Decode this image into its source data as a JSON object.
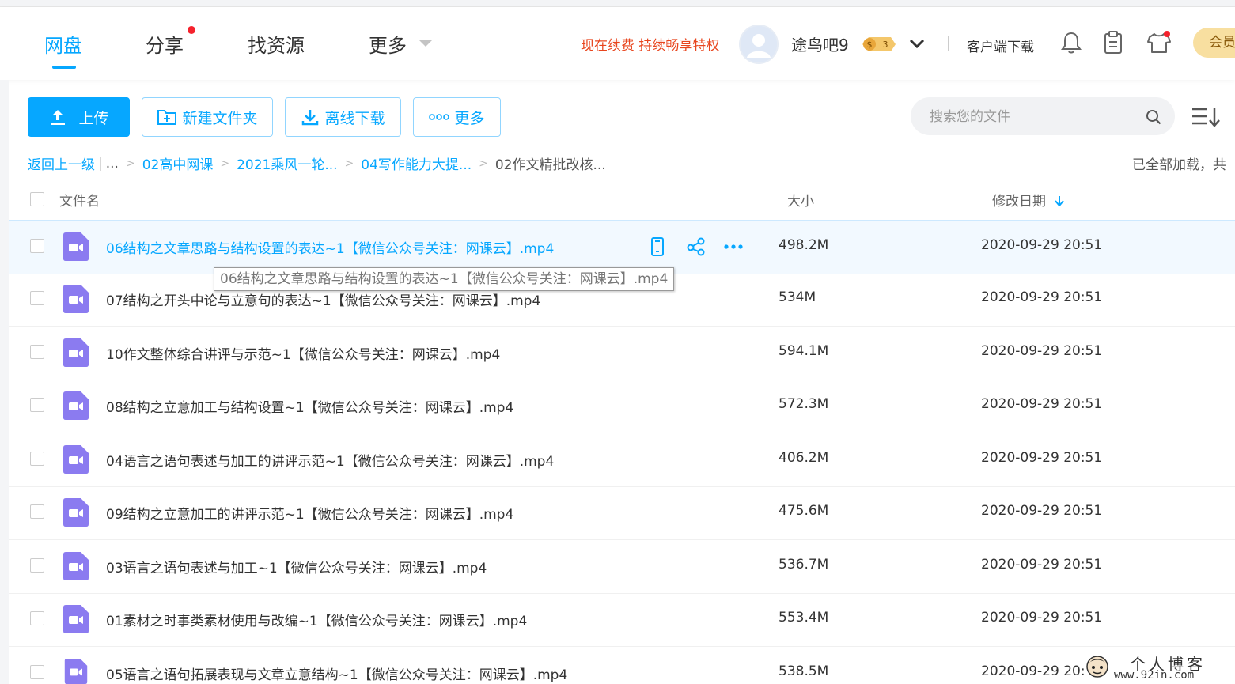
{
  "nav": {
    "items": [
      {
        "label": "网盘",
        "active": true
      },
      {
        "label": "分享",
        "badge": true
      },
      {
        "label": "找资源"
      },
      {
        "label": "更多",
        "dropdown": true
      }
    ]
  },
  "header": {
    "promo": "现在续费 持续畅享特权",
    "username": "途鸟吧9",
    "coin_level": "3",
    "client_download": "客户端下载",
    "vip_label": "会员"
  },
  "toolbar": {
    "upload": "上传",
    "new_folder": "新建文件夹",
    "offline_download": "离线下载",
    "more": "更多",
    "search_placeholder": "搜索您的文件"
  },
  "breadcrumb": {
    "back": "返回上一级",
    "ellipsis": "...",
    "items": [
      "02高中网课",
      "2021乘风一轮...",
      "04写作能力大提..."
    ],
    "current": "02作文精批改核..."
  },
  "status": {
    "loaded": "已全部加载，共"
  },
  "table": {
    "columns": {
      "name": "文件名",
      "size": "大小",
      "date": "修改日期"
    },
    "rows": [
      {
        "name": "06结构之文章思路与结构设置的表达~1【微信公众号关注：网课云】.mp4",
        "size": "498.2M",
        "date": "2020-09-29 20:51"
      },
      {
        "name": "07结构之开头中论与立意句的表达~1【微信公众号关注：网课云】.mp4",
        "size": "534M",
        "date": "2020-09-29 20:51"
      },
      {
        "name": "10作文整体综合讲评与示范~1【微信公众号关注：网课云】.mp4",
        "size": "594.1M",
        "date": "2020-09-29 20:51"
      },
      {
        "name": "08结构之立意加工与结构设置~1【微信公众号关注：网课云】.mp4",
        "size": "572.3M",
        "date": "2020-09-29 20:51"
      },
      {
        "name": "04语言之语句表述与加工的讲评示范~1【微信公众号关注：网课云】.mp4",
        "size": "406.2M",
        "date": "2020-09-29 20:51"
      },
      {
        "name": "09结构之立意加工的讲评示范~1【微信公众号关注：网课云】.mp4",
        "size": "475.6M",
        "date": "2020-09-29 20:51"
      },
      {
        "name": "03语言之语句表述与加工~1【微信公众号关注：网课云】.mp4",
        "size": "536.7M",
        "date": "2020-09-29 20:51"
      },
      {
        "name": "01素材之时事类素材使用与改编~1【微信公众号关注：网课云】.mp4",
        "size": "553.4M",
        "date": "2020-09-29 20:51"
      },
      {
        "name": "05语言之语句拓展表现与文章立意结构~1【微信公众号关注：网课云】.mp4",
        "size": "538.5M",
        "date": "2020-09-29 20:51"
      }
    ]
  },
  "tooltip": "06结构之文章思路与结构设置的表达~1【微信公众号关注：网课云】.mp4",
  "watermark": {
    "line1": "个人博客",
    "line2": "www.92in.com"
  },
  "colors": {
    "accent": "#06a7ff",
    "promo": "#e8451e",
    "file_icon": "#8b7bf0",
    "vip": "#f8dfa0"
  }
}
